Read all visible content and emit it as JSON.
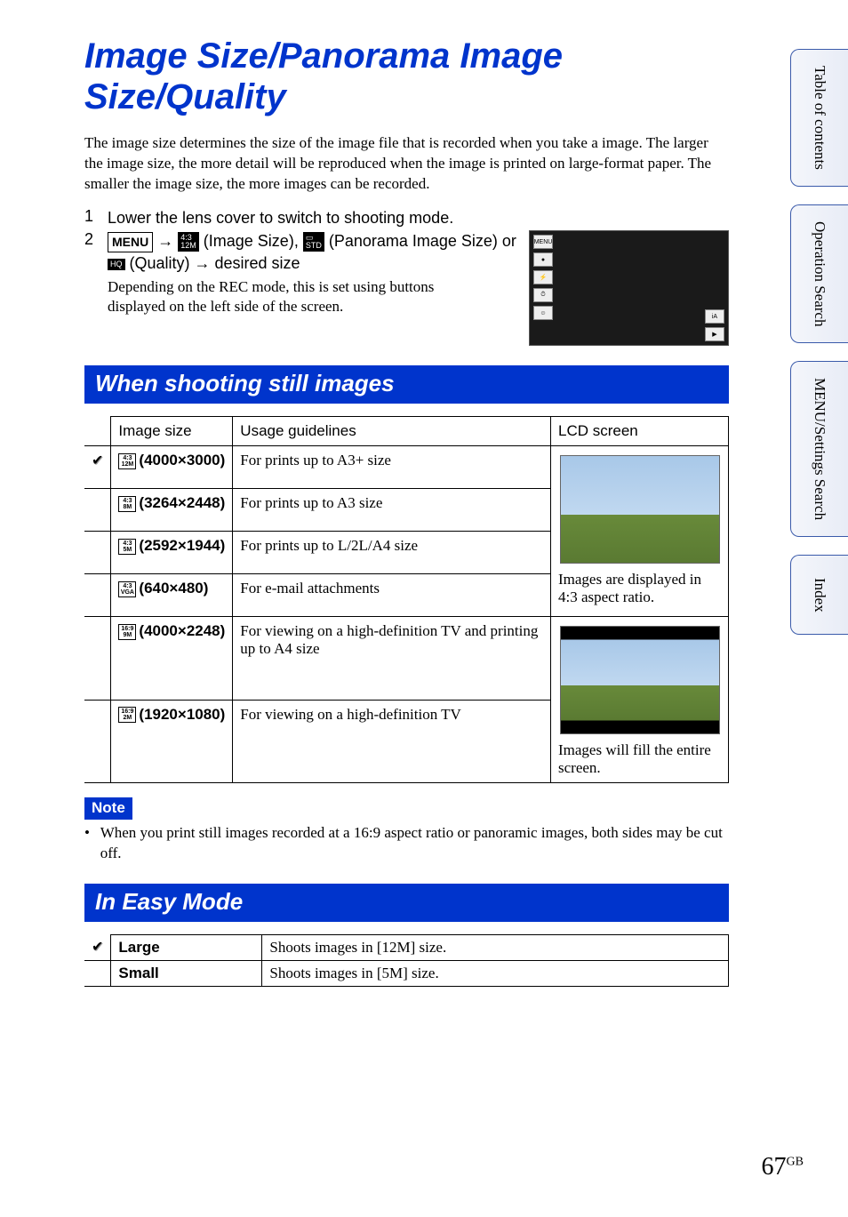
{
  "title": "Image Size/Panorama Image Size/Quality",
  "intro": "The image size determines the size of the image file that is recorded when you take a image. The larger the image size, the more detail will be reproduced when the image is printed on large-format paper. The smaller the image size, the more images can be recorded.",
  "steps": {
    "s1": "Lower the lens cover to switch to shooting mode.",
    "menu_label": "MENU",
    "arrow": "→",
    "img_size_label": " (Image Size), ",
    "pano_label": " (Panorama Image Size) or ",
    "quality_label": " (Quality) ",
    "desired": " desired size",
    "dep": "Depending on the REC mode, this is set using buttons displayed on the left side of the screen."
  },
  "section1": "When shooting still images",
  "table1": {
    "h1": "Image size",
    "h2": "Usage guidelines",
    "h3": "LCD screen",
    "rows": [
      {
        "asp": "4:3",
        "mp": "12M",
        "size": "(4000×3000)",
        "usage": "For prints up to A3+ size",
        "checked": true
      },
      {
        "asp": "4:3",
        "mp": "8M",
        "size": "(3264×2448)",
        "usage": "For prints up to A3 size"
      },
      {
        "asp": "4:3",
        "mp": "5M",
        "size": "(2592×1944)",
        "usage": "For prints up to L/2L/A4 size"
      },
      {
        "asp": "4:3",
        "mp": "VGA",
        "size": "(640×480)",
        "usage": "For e-mail attachments"
      },
      {
        "asp": "16:9",
        "mp": "9M",
        "size": "(4000×2248)",
        "usage": "For viewing on a high-definition TV and printing up to A4 size"
      },
      {
        "asp": "16:9",
        "mp": "2M",
        "size": "(1920×1080)",
        "usage": "For viewing on a high-definition TV"
      }
    ],
    "lcd1": "Images are displayed in 4:3 aspect ratio.",
    "lcd2": "Images will fill the entire screen."
  },
  "note_label": "Note",
  "note_body": "When you print still images recorded at a 16:9 aspect ratio or panoramic images, both sides may be cut off.",
  "section2": "In Easy Mode",
  "table2": {
    "r1l": "Large",
    "r1d": "Shoots images in [12M] size.",
    "r2l": "Small",
    "r2d": "Shoots images in [5M] size."
  },
  "page_num": "67",
  "page_suffix": "GB",
  "tabs": [
    "Table of contents",
    "Operation Search",
    "MENU/Settings Search",
    "Index"
  ]
}
